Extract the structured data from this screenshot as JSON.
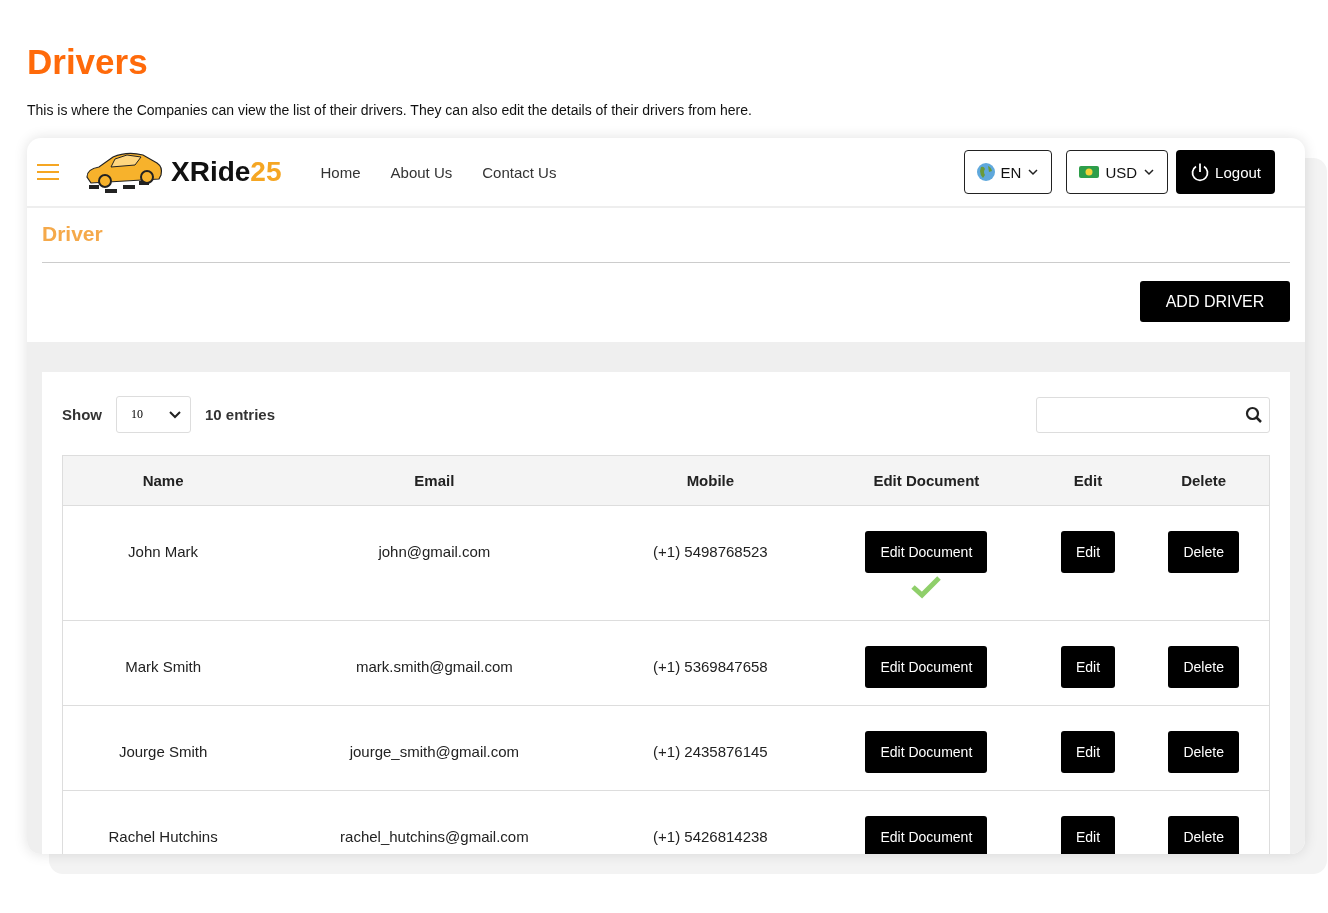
{
  "page": {
    "title": "Drivers",
    "description": "This is where the Companies can view the list of their drivers. They can also edit the details of their drivers from here."
  },
  "navbar": {
    "brand": {
      "name": "XRide",
      "suffix": "25"
    },
    "links": [
      "Home",
      "About Us",
      "Contact Us"
    ],
    "language": "EN",
    "currency": "USD",
    "logout": "Logout"
  },
  "section": {
    "title": "Driver",
    "add_button": "ADD DRIVER"
  },
  "table_controls": {
    "show_label": "Show",
    "page_size": "10",
    "entries_label": "10 entries"
  },
  "table": {
    "columns": [
      "Name",
      "Email",
      "Mobile",
      "Edit Document",
      "Edit",
      "Delete"
    ],
    "rows": [
      {
        "name": "John Mark",
        "email": "john@gmail.com",
        "mobile": "(+1) 5498768523",
        "edit_document": "Edit Document",
        "edit": "Edit",
        "delete": "Delete",
        "document_verified": true
      },
      {
        "name": "Mark Smith",
        "email": "mark.smith@gmail.com",
        "mobile": "(+1) 5369847658",
        "edit_document": "Edit Document",
        "edit": "Edit",
        "delete": "Delete",
        "document_verified": false
      },
      {
        "name": "Jourge Smith",
        "email": "jourge_smith@gmail.com",
        "mobile": "(+1) 2435876145",
        "edit_document": "Edit Document",
        "edit": "Edit",
        "delete": "Delete",
        "document_verified": false
      },
      {
        "name": "Rachel Hutchins",
        "email": "rachel_hutchins@gmail.com",
        "mobile": "(+1) 5426814238",
        "edit_document": "Edit Document",
        "edit": "Edit",
        "delete": "Delete",
        "document_verified": false
      }
    ]
  }
}
